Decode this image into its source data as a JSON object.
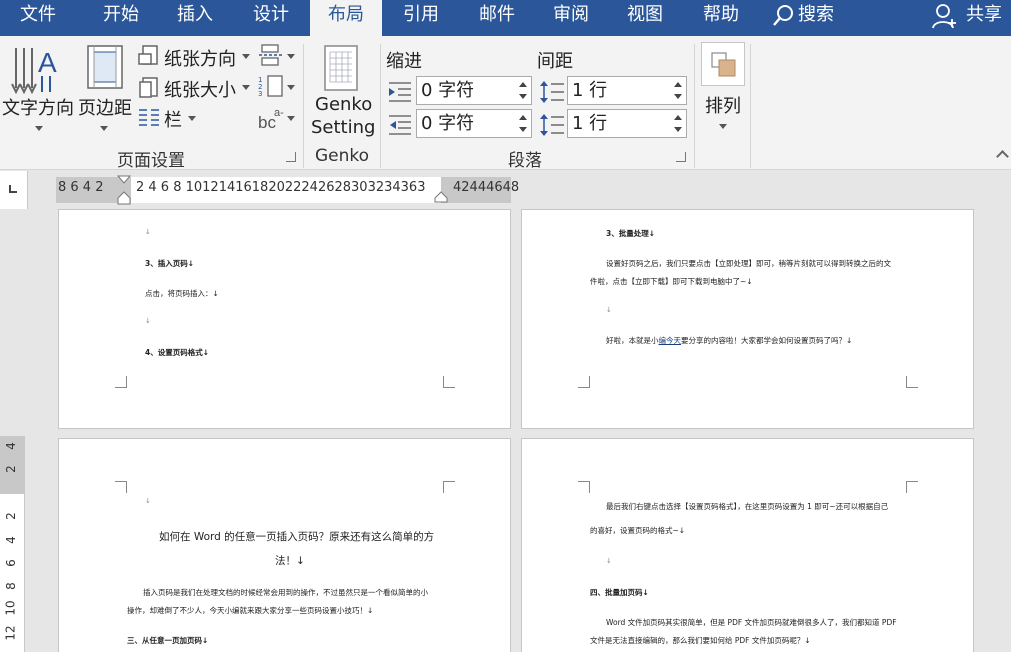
{
  "tabs": [
    "文件",
    "开始",
    "插入",
    "设计",
    "布局",
    "引用",
    "邮件",
    "审阅",
    "视图",
    "帮助"
  ],
  "active_tab": "布局",
  "search_label": "搜索",
  "share_label": "共享",
  "ribbon": {
    "text_direction": "文字方向",
    "margins": "页边距",
    "orientation": "纸张方向",
    "size": "纸张大小",
    "columns": "栏",
    "page_setup_label": "页面设置",
    "genko_line1": "Genko",
    "genko_line2": "Setting",
    "genko_label": "Genko",
    "indent_label": "缩进",
    "spacing_label": "间距",
    "indent_left": "0 字符",
    "indent_right": "0 字符",
    "spacing_before": "1 行",
    "spacing_after": "1 行",
    "paragraph_label": "段落",
    "arrange": "排列"
  },
  "ruler": {
    "left_numbers": "8  6  4  2",
    "main_numbers": "2  4  6  8 10121416182022242628303234363",
    "right_numbers": "42444648"
  },
  "vruler_numbers": [
    "4",
    "2",
    "2",
    "4",
    "6",
    "8",
    "10",
    "12"
  ],
  "pages": {
    "p1": {
      "h3": "3、插入页码↓",
      "t1": "点击，将页码插入：↓",
      "h4": "4、设置页码格式↓"
    },
    "p2": {
      "h3": "3、批量处理↓",
      "t1": "设置好页码之后，我们只要点击【立即处理】即可，稍等片刻就可以得到转换之后的文",
      "t2": "件啦，点击【立即下载】即可下载到电脑中了~↓",
      "t3a": "好啦，本就是小",
      "t3link": "编今天",
      "t3b": "要分享的内容啦！大家都学会如何设置页码了吗？↓"
    },
    "p3": {
      "title1": "如何在 Word 的任意一页插入页码？原来还有这么简单的方",
      "title2": "法！↓",
      "t1": "插入页码是我们在处理文档的时候经常会用到的操作，不过虽然只是一个看似简单的小",
      "t2": "操作，却难倒了不少人，今天小编就来跟大家分享一些页码设置小技巧！↓",
      "h1": "三、从任意一页加页码↓"
    },
    "p4": {
      "t1": "最后我们右键点击选择【设置页码格式】，在这里页码设置为 1 即可~还可以根据自己",
      "t2": "的喜好，设置页码的格式~↓",
      "h4": "四、批量加页码↓",
      "t3": "Word 文件加页码其实很简单，但是 PDF 文件加页码就难倒很多人了，我们都知道 PDF",
      "t4": "文件是无法直接编辑的，那么我们要如何给 PDF 文件加页码呢？↓"
    }
  },
  "colors": {
    "accent": "#2b579a",
    "ribbon": "#f3f3f3",
    "workspace": "#e6e6e6"
  }
}
